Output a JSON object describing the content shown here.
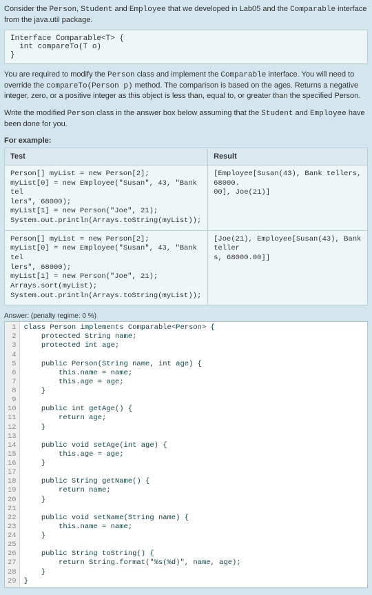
{
  "intro_prefix": "Consider the ",
  "intro_c1": "Person",
  "intro_mid1": ", ",
  "intro_c2": "Student",
  "intro_mid2": " and ",
  "intro_c3": "Employee",
  "intro_mid3": " that we developed in Lab05 and the ",
  "intro_c4": "Comparable",
  "intro_mid4": " interface from the java.util package.",
  "interface_code": "Interface Comparable<T> {\n  int compareTo(T o)\n}",
  "req_p1": "You are required to modify the ",
  "req_c1": "Person",
  "req_p2": " class and implement the ",
  "req_c2": "Comparable",
  "req_p3": " interface. You will need to override the ",
  "req_c3": "compareTo(Person p)",
  "req_p4": " method. The comparison is based on the ages. Returns a negative integer, zero, or a positive integer as this object is less than, equal to, or greater than the specified Person.",
  "write_p1": "Write the modified ",
  "write_c1": "Person",
  "write_p2": " class in the answer box below assuming that the ",
  "write_c2": "Student",
  "write_p3": " and ",
  "write_c3": "Employee",
  "write_p4": " have been done for you.",
  "for_example": "For example:",
  "table": {
    "h_test": "Test",
    "h_result": "Result",
    "rows": [
      {
        "test": "Person[] myList = new Person[2];\nmyList[0] = new Employee(\"Susan\", 43, \"Bank tel\nlers\", 68000);\nmyList[1] = new Person(\"Joe\", 21);\nSystem.out.println(Arrays.toString(myList));",
        "result": "[Employee[Susan(43), Bank tellers, 68000.\n00], Joe(21)]"
      },
      {
        "test": "Person[] myList = new Person[2];\nmyList[0] = new Employee(\"Susan\", 43, \"Bank tel\nlers\", 68000);\nmyList[1] = new Person(\"Joe\", 21);\nArrays.sort(myList);\nSystem.out.println(Arrays.toString(myList));",
        "result": "[Joe(21), Employee[Susan(43), Bank teller\ns, 68000.00]]"
      }
    ]
  },
  "answer_label": "Answer: (penalty regime: 0 %)",
  "line_count": 29,
  "code_lines": [
    "class Person implements Comparable<Person> {",
    "    protected String name;",
    "    protected int age;",
    "",
    "    public Person(String name, int age) {",
    "        this.name = name;",
    "        this.age = age;",
    "    }",
    "",
    "    public int getAge() {",
    "        return age;",
    "    }",
    "",
    "    public void setAge(int age) {",
    "        this.age = age;",
    "    }",
    "",
    "    public String getName() {",
    "        return name;",
    "    }",
    "",
    "    public void setName(String name) {",
    "        this.name = name;",
    "    }",
    "",
    "    public String toString() {",
    "        return String.format(\"%s(%d)\", name, age);",
    "    }",
    "}"
  ]
}
